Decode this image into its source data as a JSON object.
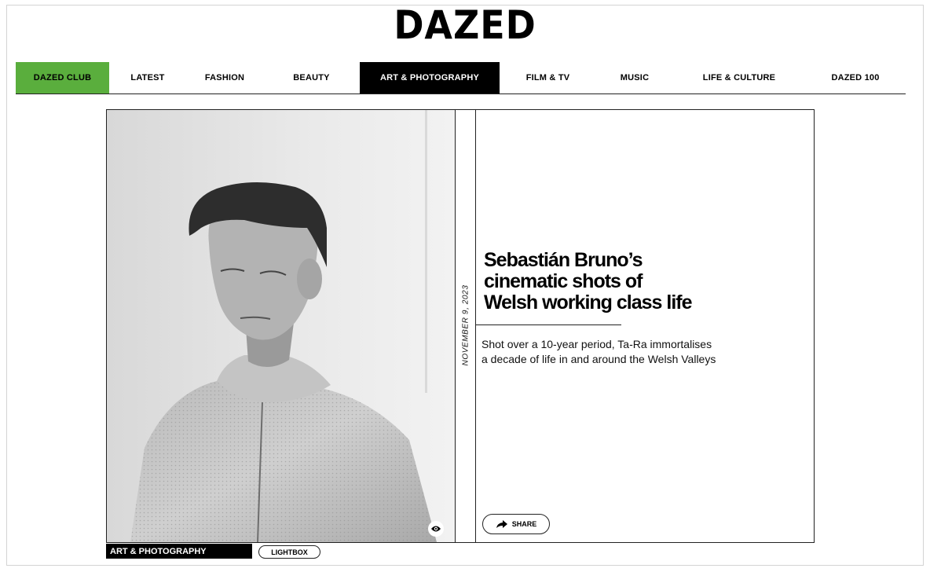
{
  "brand": {
    "logo_text": "DAZED"
  },
  "nav": {
    "items": [
      {
        "label": "DAZED CLUB"
      },
      {
        "label": "LATEST"
      },
      {
        "label": "FASHION"
      },
      {
        "label": "BEAUTY"
      },
      {
        "label": "ART & PHOTOGRAPHY"
      },
      {
        "label": "FILM & TV"
      },
      {
        "label": "MUSIC"
      },
      {
        "label": "LIFE & CULTURE"
      },
      {
        "label": "DAZED 100"
      }
    ],
    "active_item": "ART & PHOTOGRAPHY",
    "club_color": "#5aae3d"
  },
  "article": {
    "date": "NOVEMBER 9, 2023",
    "headline_lines": [
      "Sebastián Bruno’s",
      "cinematic shots of",
      "Welsh working class life"
    ],
    "standfirst_lines": [
      "Shot over a 10-year period, Ta-Ra immortalises",
      "a decade of life in and around the Welsh Valleys"
    ],
    "share_label": "SHARE",
    "category_tag": "ART & PHOTOGRAPHY",
    "lightbox_label": "LIGHTBOX",
    "image_view_icon": "eye-icon",
    "share_icon": "share-arrow-icon"
  }
}
